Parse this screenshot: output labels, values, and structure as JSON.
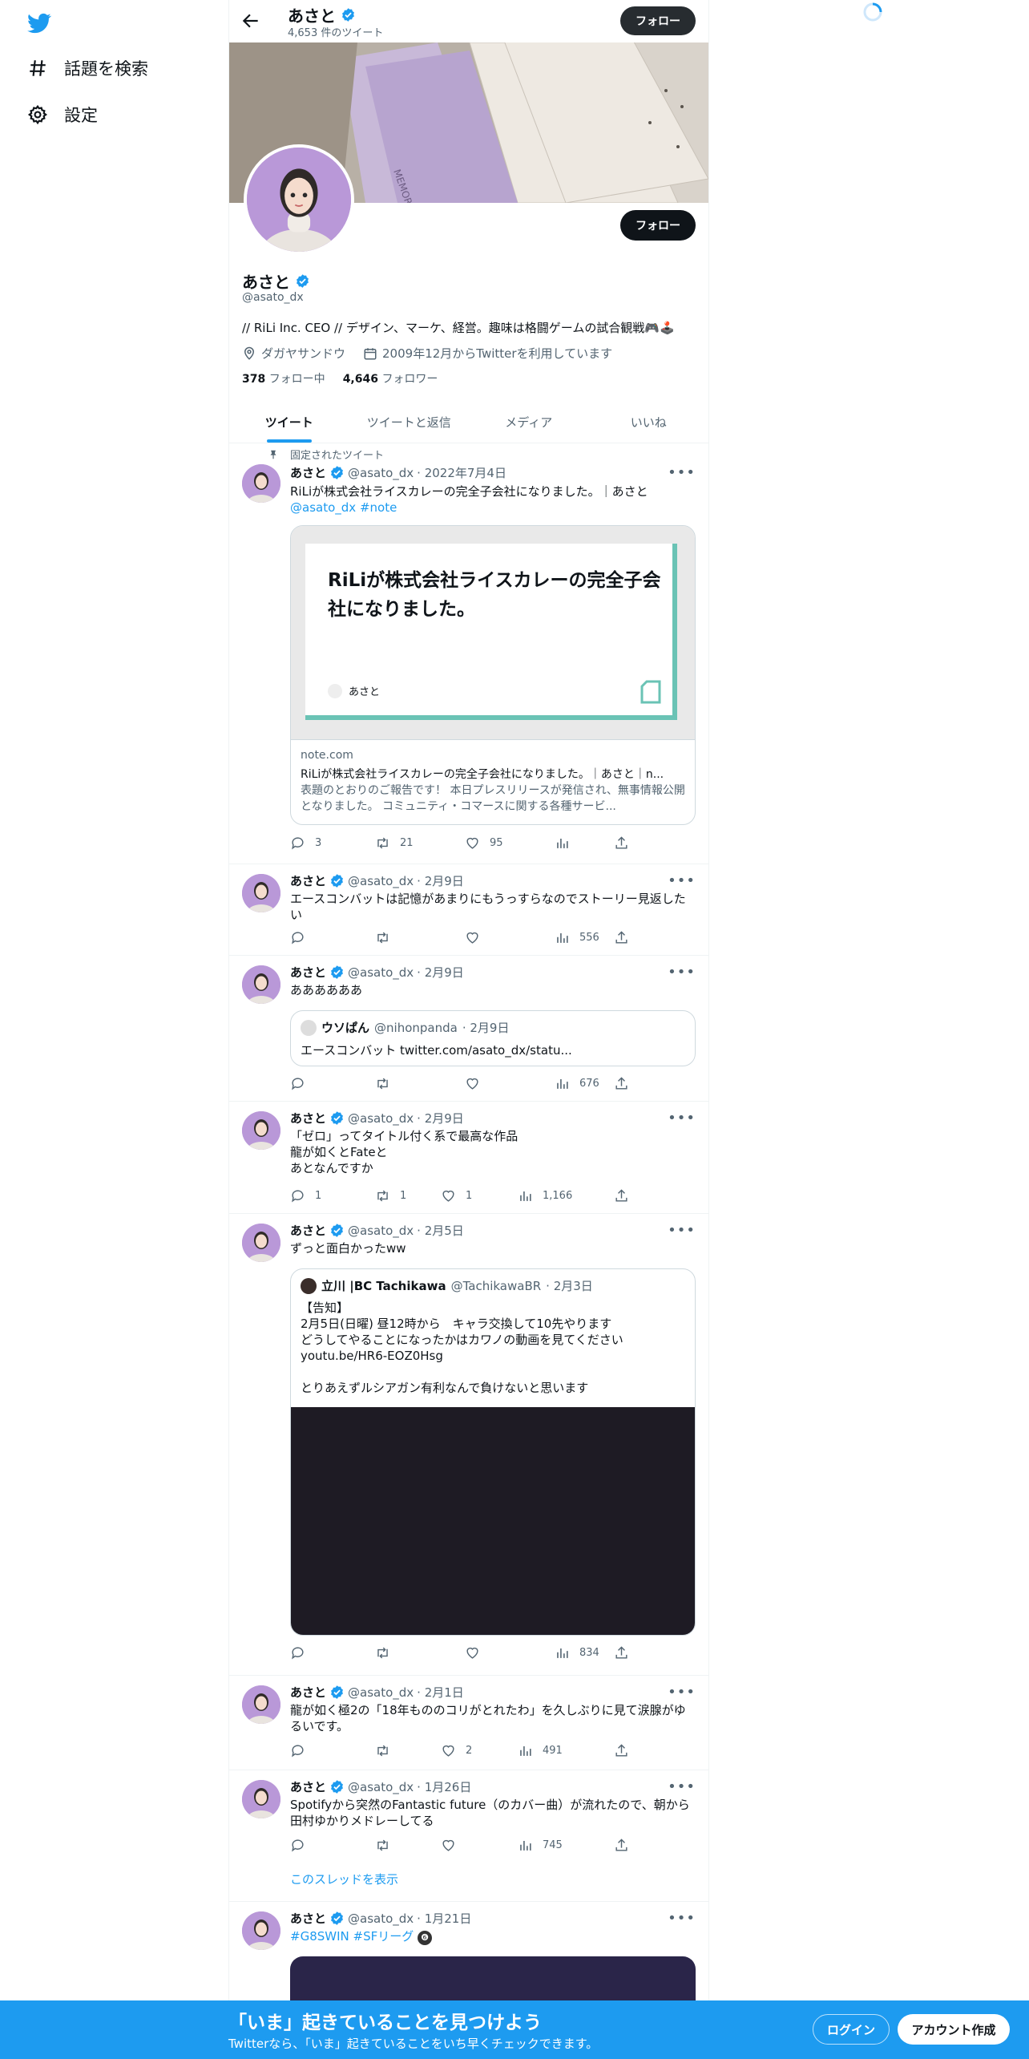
{
  "nav": {
    "explore": "話題を検索",
    "settings": "設定"
  },
  "topbar": {
    "name": "あさと",
    "tweet_count": "4,653 件のツイート",
    "follow": "フォロー"
  },
  "profile": {
    "name": "あさと",
    "handle": "@asato_dx",
    "bio": "// RiLi Inc. CEO // デザイン、マーケ、経営。趣味は格闘ゲームの試合観戦🎮🕹️",
    "location": "ダガヤサンドウ",
    "joined": "2009年12月からTwitterを利用しています",
    "following_count": "378",
    "following_label": "フォロー中",
    "followers_count": "4,646",
    "followers_label": "フォロワー",
    "follow": "フォロー",
    "banner_text": "MEMORIES"
  },
  "tabs": [
    "ツイート",
    "ツイートと返信",
    "メディア",
    "いいね"
  ],
  "pinned_label": "固定されたツイート",
  "tweets": [
    {
      "name": "あさと",
      "handle": "@asato_dx",
      "date": "· 2022年7月4日",
      "text": "RiLiが株式会社ライスカレーの完全子会社になりました。｜あさと",
      "mention": "@asato_dx",
      "hashtag": "#note",
      "card": {
        "image_title": "RiLiが株式会社ライスカレーの完全子会社になりました。",
        "image_author": "あさと",
        "domain": "note.com",
        "title": "RiLiが株式会社ライスカレーの完全子会社になりました。｜あさと｜n...",
        "desc": "表題のとおりのご報告です！ 本日プレスリリースが発信され、無事情報公開となりました。 コミュニティ・コマースに関する各種サービ..."
      },
      "reply": "3",
      "retweet": "21",
      "like": "95",
      "views": ""
    },
    {
      "name": "あさと",
      "handle": "@asato_dx",
      "date": "· 2月9日",
      "text": "エースコンバットは記憶があまりにもうっすらなのでストーリー見返したい",
      "reply": "",
      "retweet": "",
      "like": "",
      "views": "556"
    },
    {
      "name": "あさと",
      "handle": "@asato_dx",
      "date": "· 2月9日",
      "text": "ああああああ",
      "quote": {
        "name": "ウソぱん",
        "handle": "@nihonpanda",
        "date": "· 2月9日",
        "text": "エースコンバット twitter.com/asato_dx/statu..."
      },
      "reply": "",
      "retweet": "",
      "like": "",
      "views": "676"
    },
    {
      "name": "あさと",
      "handle": "@asato_dx",
      "date": "· 2月9日",
      "text": "「ゼロ」ってタイトル付く系で最高な作品\n龍が如くとFateと\nあとなんですか",
      "reply": "1",
      "retweet": "1",
      "like": "1",
      "views": "1,166"
    },
    {
      "name": "あさと",
      "handle": "@asato_dx",
      "date": "· 2月5日",
      "text": "ずっと面白かったww",
      "quote": {
        "name": "立川 |BC Tachikawa",
        "handle": "@TachikawaBR",
        "date": "· 2月3日",
        "text": "【告知】\n2月5日(日曜) 昼12時から　キャラ交換して10先やります\nどうしてやることになったかはカワノの動画を見てください\nyoutu.be/HR6-EOZ0Hsg\n\nとりあえずルシアガン有利なんで負けないと思います"
      },
      "reply": "",
      "retweet": "",
      "like": "",
      "views": "834"
    },
    {
      "name": "あさと",
      "handle": "@asato_dx",
      "date": "· 2月1日",
      "text": "龍が如く極2の「18年もののコリがとれたわ」を久しぶりに見て涙腺がゆるいです。",
      "reply": "",
      "retweet": "",
      "like": "2",
      "views": "491"
    },
    {
      "name": "あさと",
      "handle": "@asato_dx",
      "date": "· 1月26日",
      "text": "Spotifyから突然のFantastic future（のカバー曲）が流れたので、朝から田村ゆかりメドレーしてる",
      "thread": "このスレッドを表示",
      "reply": "",
      "retweet": "",
      "like": "",
      "views": "745"
    },
    {
      "name": "あさと",
      "handle": "@asato_dx",
      "date": "· 1月21日",
      "text": "#G8SWIN #SFリーグ",
      "emoji": "❻"
    }
  ],
  "bottom": {
    "title": "「いま」起きていることを見つけよう",
    "subtitle": "Twitterなら、「いま」起きていることをいち早くチェックできます。",
    "login": "ログイン",
    "signup": "アカウント作成"
  },
  "colors": {
    "accent": "#1d9bf0",
    "dark_button": "#0f1419",
    "secondary_text": "#536471",
    "avatar_bg": "#b998d8"
  }
}
